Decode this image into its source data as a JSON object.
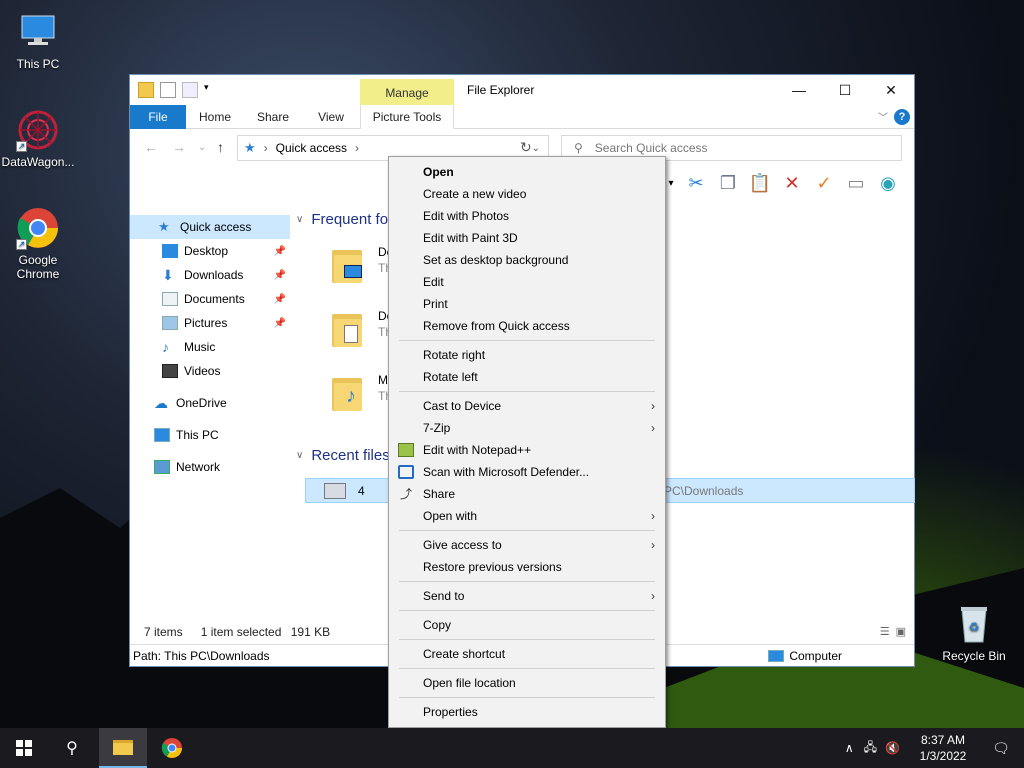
{
  "desktop": {
    "icons": [
      {
        "label": "This PC",
        "icon": "monitor-icon"
      },
      {
        "label": "DataWagon...",
        "icon": "datawagon-icon"
      },
      {
        "label": "Google Chrome",
        "icon": "chrome-icon"
      },
      {
        "label": "Recycle Bin",
        "icon": "recycle-bin-icon"
      }
    ]
  },
  "window": {
    "title": "File Explorer",
    "contextual_tab_group": "Manage",
    "ribbon_tabs": [
      "File",
      "Home",
      "Share",
      "View",
      "Picture Tools"
    ],
    "address": {
      "location": "Quick access"
    },
    "search_placeholder": "Search Quick access",
    "nav": [
      {
        "label": "Quick access",
        "selected": true
      },
      {
        "label": "Desktop",
        "pinned": true
      },
      {
        "label": "Downloads",
        "pinned": true
      },
      {
        "label": "Documents",
        "pinned": true
      },
      {
        "label": "Pictures",
        "pinned": true
      },
      {
        "label": "Music"
      },
      {
        "label": "Videos"
      },
      {
        "label": "OneDrive"
      },
      {
        "label": "This PC"
      },
      {
        "label": "Network"
      }
    ],
    "groups": {
      "frequent": "Frequent fo",
      "recent": "Recent files"
    },
    "frequent_items": [
      {
        "name": "De",
        "sub": "Th"
      },
      {
        "name": "Do",
        "sub": "Th"
      },
      {
        "name": "M",
        "sub": "Th"
      }
    ],
    "recent_item": {
      "name": "4",
      "path": "PC\\Downloads"
    },
    "status": {
      "items": "7 items",
      "selected": "1 item selected",
      "size": "191 KB"
    },
    "pathbar": {
      "path": "Path: This PC\\Downloads",
      "zone": "Computer"
    }
  },
  "context_menu": {
    "items": [
      {
        "label": "Open",
        "bold": true
      },
      {
        "label": "Create a new video"
      },
      {
        "label": "Edit with Photos"
      },
      {
        "label": "Edit with Paint 3D"
      },
      {
        "label": "Set as desktop background"
      },
      {
        "label": "Edit"
      },
      {
        "label": "Print"
      },
      {
        "label": "Remove from Quick access"
      },
      {
        "sep": true
      },
      {
        "label": "Rotate right"
      },
      {
        "label": "Rotate left"
      },
      {
        "sep": true
      },
      {
        "label": "Cast to Device",
        "submenu": true
      },
      {
        "label": "7-Zip",
        "submenu": true
      },
      {
        "label": "Edit with Notepad++",
        "icon": "notepadpp-icon"
      },
      {
        "label": "Scan with Microsoft Defender...",
        "icon": "defender-icon"
      },
      {
        "label": "Share",
        "icon": "share-icon"
      },
      {
        "label": "Open with",
        "submenu": true
      },
      {
        "sep": true
      },
      {
        "label": "Give access to",
        "submenu": true
      },
      {
        "label": "Restore previous versions"
      },
      {
        "sep": true
      },
      {
        "label": "Send to",
        "submenu": true
      },
      {
        "sep": true
      },
      {
        "label": "Copy"
      },
      {
        "sep": true
      },
      {
        "label": "Create shortcut"
      },
      {
        "sep": true
      },
      {
        "label": "Open file location"
      },
      {
        "sep": true
      },
      {
        "label": "Properties"
      }
    ]
  },
  "taskbar": {
    "time": "8:37 AM",
    "date": "1/3/2022"
  }
}
